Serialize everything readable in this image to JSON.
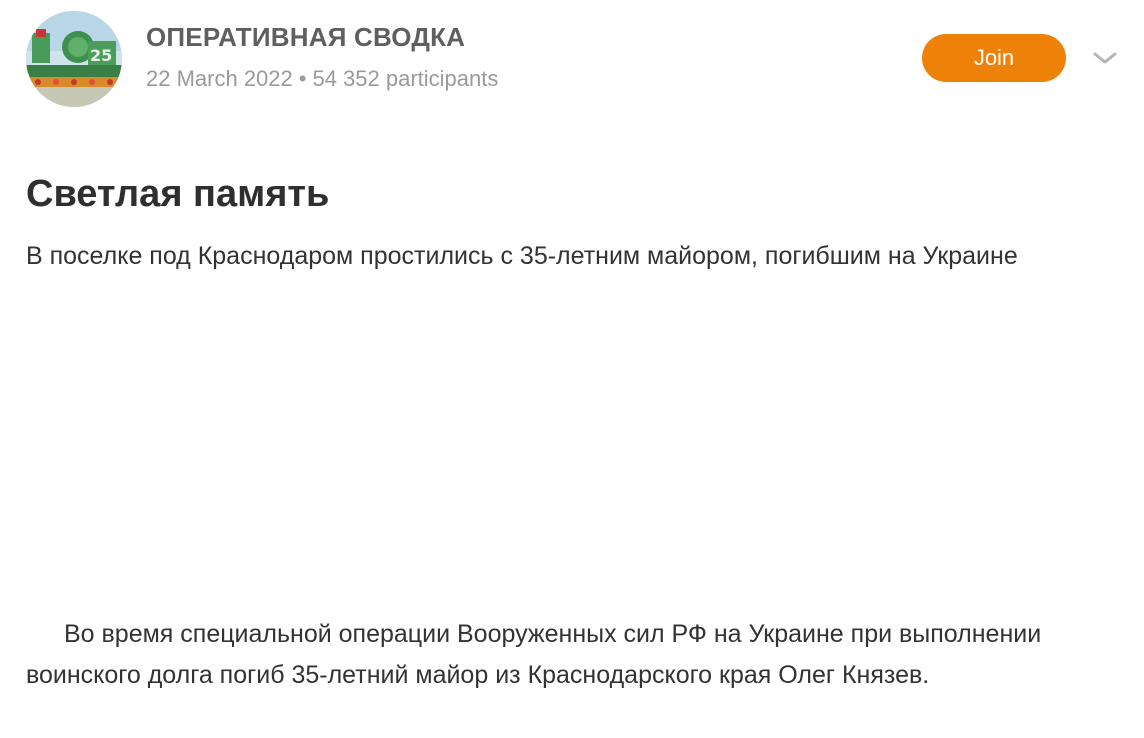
{
  "group": {
    "name": "ОПЕРАТИВНАЯ СВОДКА",
    "date": "22 March 2022",
    "separator": "•",
    "participants": "54 352 participants"
  },
  "actions": {
    "join_label": "Join",
    "expand_icon": "chevron-down-icon",
    "join_color": "#ee8208"
  },
  "article": {
    "title": "Светлая память",
    "subtitle": "В поселке под Краснодаром простились с 35-летним майором, погибшим на Украине",
    "body": "Во время специальной операции Вооруженных сил РФ на Украине при выполнении воинского долга погиб 35-летний майор из Краснодарского края Олег Князев."
  }
}
